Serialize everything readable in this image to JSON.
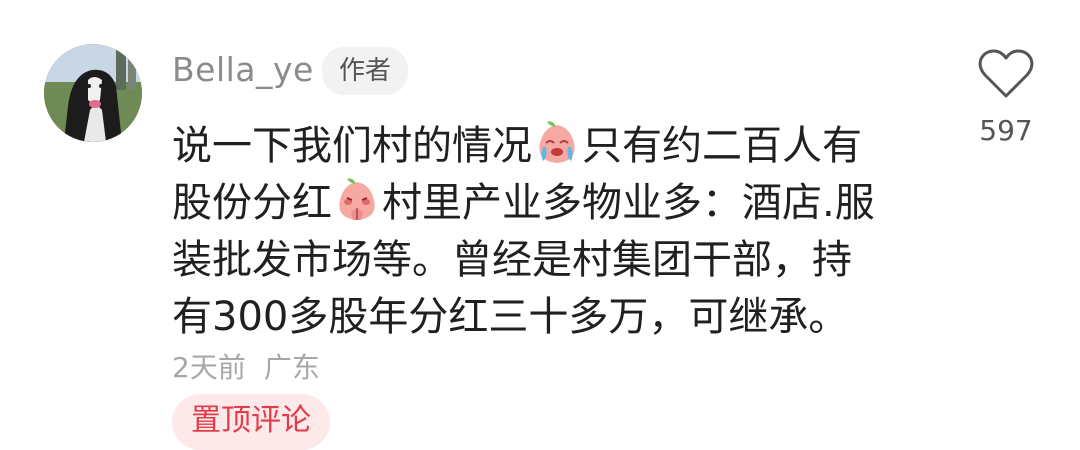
{
  "comment": {
    "author": "Bella_ye",
    "author_badge": "作者",
    "lines": [
      [
        "说一下我们村的情况",
        "只有约二百人有"
      ],
      [
        "股份分红",
        "村里产业多物业多：酒店.服"
      ],
      [
        "装批发市场等。曾经是村集团干部，持"
      ],
      [
        "有300多股年分红三十多万，可继承。"
      ]
    ],
    "emojis": [
      "crying-peach-emoji",
      "bowing-peach-emoji"
    ],
    "time": "2天前",
    "location": "广东",
    "pin_label": "置顶评论",
    "likes": "597",
    "like_icon": "heart-outline-icon",
    "colors": {
      "pin_text": "#e33b47",
      "pin_bg": "#fde9ea",
      "meta_text": "#a8a8a8"
    }
  }
}
